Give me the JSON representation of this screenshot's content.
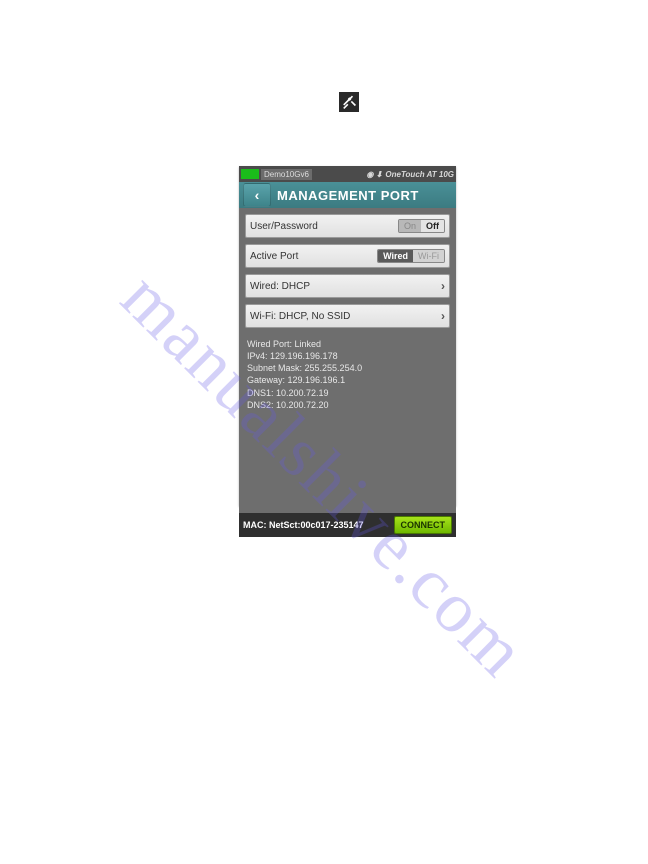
{
  "watermark": "manualshive.com",
  "tools_icon_name": "tools-icon",
  "device": {
    "statusbar": {
      "profile": "Demo10Gv6",
      "product": "OneTouch AT 10G"
    },
    "title": "MANAGEMENT PORT",
    "rows": {
      "user_password": {
        "label": "User/Password",
        "on": "On",
        "off": "Off"
      },
      "active_port": {
        "label": "Active Port",
        "wired": "Wired",
        "wifi": "Wi-Fi"
      },
      "wired": {
        "label": "Wired: DHCP"
      },
      "wifi": {
        "label": "Wi-Fi: DHCP, No SSID"
      }
    },
    "info": {
      "line1": "Wired Port: Linked",
      "line2": "IPv4: 129.196.196.178",
      "line3": "Subnet Mask: 255.255.254.0",
      "line4": "Gateway: 129.196.196.1",
      "line5": "DNS1: 10.200.72.19",
      "line6": "DNS2: 10.200.72.20"
    },
    "footer": {
      "mac": "MAC: NetSct:00c017-235147",
      "connect": "CONNECT"
    }
  }
}
